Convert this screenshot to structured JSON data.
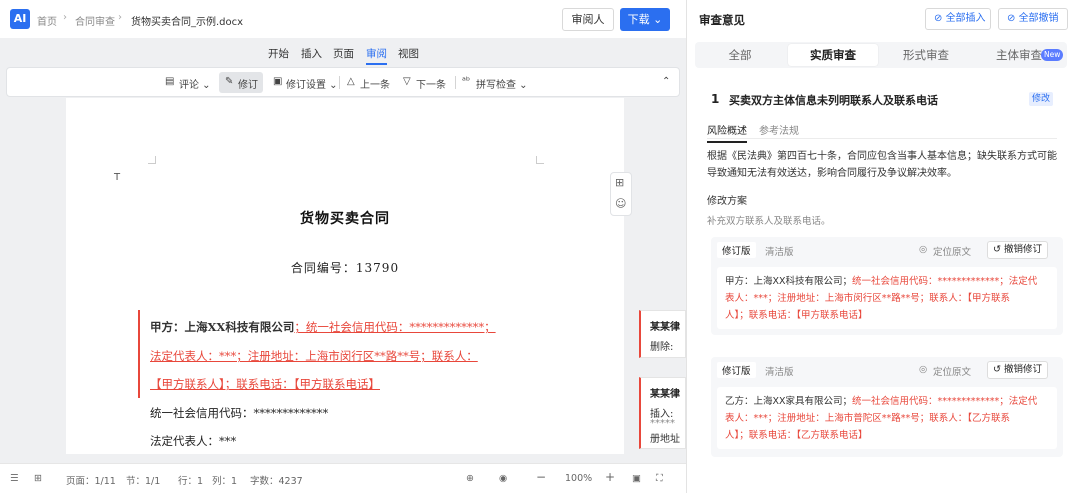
{
  "topbar": {
    "logo": "AI",
    "breadcrumb": [
      "首页",
      "合同审查",
      "货物买卖合同_示例.docx"
    ],
    "share_label": "审阅人",
    "download_label": "下载 ⌄"
  },
  "menu": [
    "开始",
    "插入",
    "页面",
    "审阅",
    "视图"
  ],
  "toolbar": {
    "comment": "评论 ⌄",
    "track": "修订",
    "track_settings": "修订设置 ⌄",
    "prev": "上一条",
    "next": "下一条",
    "spell": "拼写检查 ⌄"
  },
  "document": {
    "title": "货物买卖合同",
    "contract_no": "合同编号：13790",
    "lines": [
      {
        "prefix": "甲方：上海XX科技有限公司",
        "rev": "；统一社会信用代码：*************；"
      },
      {
        "prefix": "",
        "rev": "法定代表人：***；注册地址：上海市闵行区**路**号；联系人："
      },
      {
        "prefix": "",
        "rev": "【甲方联系人】；联系电话：【甲方联系电话】"
      },
      {
        "prefix": "统一社会信用代码：*************",
        "rev": ""
      },
      {
        "prefix": "法定代表人：***",
        "rev": ""
      }
    ],
    "cursor_mark": "T"
  },
  "comments": [
    {
      "title": "某某律",
      "lines": [
        "删除:"
      ]
    },
    {
      "title": "某某律",
      "lines": [
        "插入:",
        "*****",
        "册地址"
      ]
    }
  ],
  "status": {
    "pages": "页面：1/11",
    "section": "节：1/1",
    "row": "行：1",
    "col": "列：1",
    "words": "字数：4237",
    "zoom": "100%"
  },
  "review": {
    "title": "审查意见",
    "insert_all": "全部插入",
    "cancel_all": "全部撤销",
    "tabs": [
      "全部",
      "实质审查",
      "形式审查",
      "主体审查"
    ],
    "new_badge": "New",
    "issue": {
      "num": "1",
      "title": "买卖双方主体信息未列明联系人及联系电话",
      "tag": "修改",
      "subtabs": [
        "风险概述",
        "参考法规"
      ],
      "risk": [
        "根据《民法典》第四百七十条，合同应包含当事人基本信息；缺失联系方式可能",
        "导致通知无法有效送达，影响合同履行及争议解决效率。"
      ],
      "fix_label": "修改方案",
      "fix_text": "补充双方联系人及联系电话。"
    },
    "cards": [
      {
        "tab_on": "修订版",
        "tab_off": "清洁版",
        "locate": "定位原文",
        "undo": "撤销修订",
        "lines": [
          {
            "black": "甲方：上海XX科技有限公司；",
            "red": "统一社会信用代码：*************；法定代"
          },
          {
            "black": "",
            "red": "表人：***；注册地址：上海市闵行区**路**号；联系人：【甲方联系"
          },
          {
            "black": "",
            "red": "人】；联系电话：【甲方联系电话】"
          }
        ]
      },
      {
        "tab_on": "修订版",
        "tab_off": "清洁版",
        "locate": "定位原文",
        "undo": "撤销修订",
        "lines": [
          {
            "black": "乙方：上海XX家具有限公司；",
            "red": "统一社会信用代码：*************；法定代"
          },
          {
            "black": "",
            "red": "表人：***；注册地址：上海市普陀区**路**号；联系人：【乙方联系"
          },
          {
            "black": "",
            "red": "人】；联系电话：【乙方联系电话】"
          }
        ]
      }
    ]
  },
  "colors": {
    "accent": "#2b6ff0",
    "revision": "#e8473b"
  }
}
